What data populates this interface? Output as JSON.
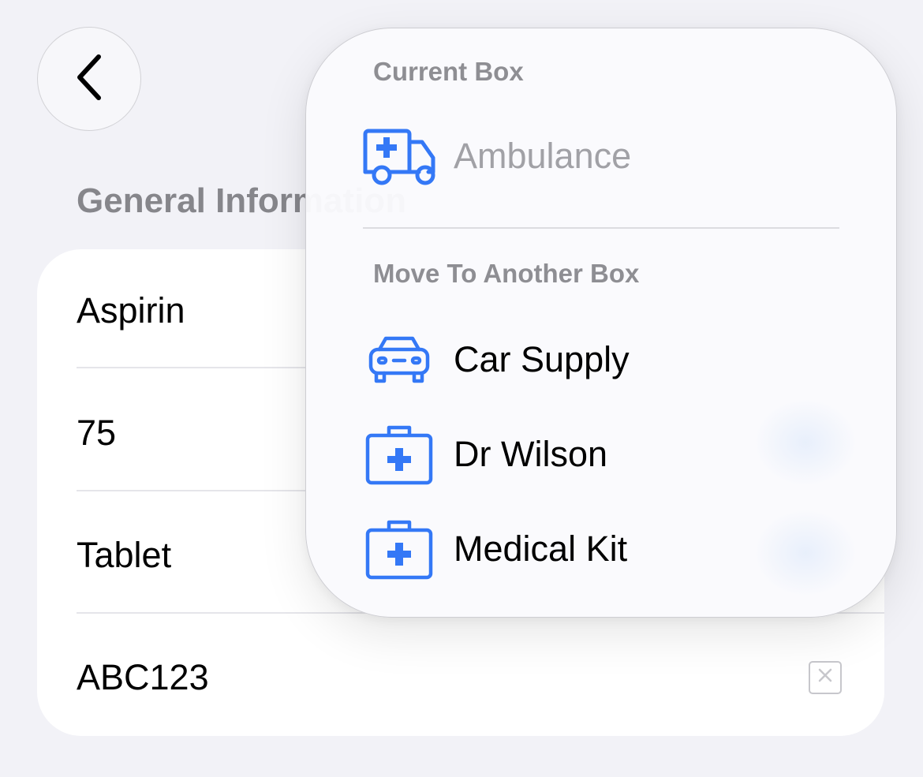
{
  "navigation": {
    "back_icon": "chevron-left-icon"
  },
  "section": {
    "title": "General Information"
  },
  "form": {
    "rows": [
      {
        "value": "Aspirin"
      },
      {
        "value": "75"
      },
      {
        "value": "Tablet"
      },
      {
        "value": "ABC123"
      }
    ],
    "clear_icon": "clear-x-icon"
  },
  "menu": {
    "current_header": "Current Box",
    "current_item": {
      "label": "Ambulance",
      "icon": "ambulance-icon"
    },
    "move_header": "Move To Another Box",
    "items": [
      {
        "label": "Car Supply",
        "icon": "car-icon"
      },
      {
        "label": "Dr Wilson",
        "icon": "medical-kit-icon"
      },
      {
        "label": "Medical Kit",
        "icon": "medical-kit-icon"
      }
    ]
  },
  "colors": {
    "accent": "#3478f6",
    "background": "#f2f2f7",
    "card": "#ffffff",
    "secondary_text": "#8e8e93"
  }
}
